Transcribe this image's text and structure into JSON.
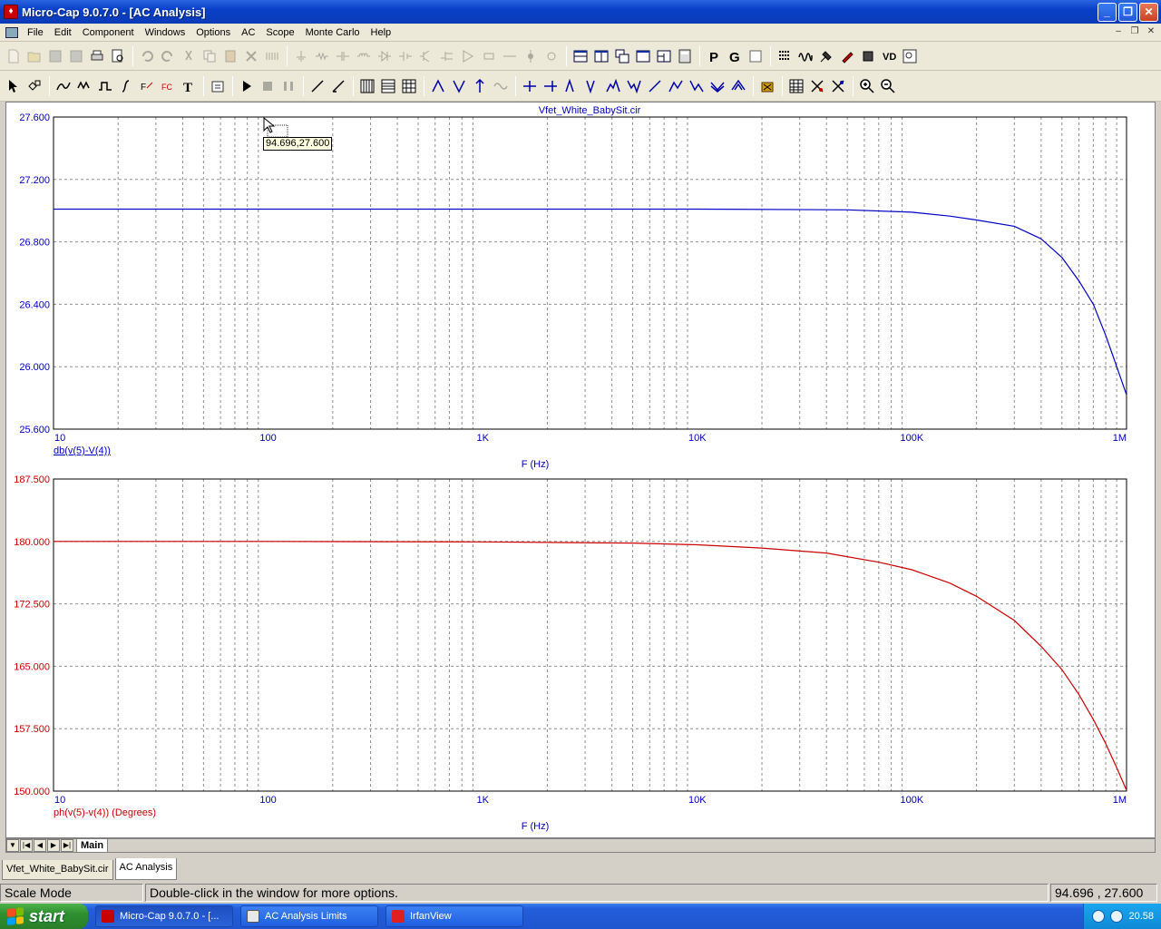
{
  "window": {
    "title": "Micro-Cap 9.0.7.0 - [AC Analysis]",
    "app_icon": "microcap-icon",
    "controls": [
      "minimize-icon",
      "restore-icon",
      "close-icon"
    ]
  },
  "menu": {
    "items": [
      "File",
      "Edit",
      "Component",
      "Windows",
      "Options",
      "AC",
      "Scope",
      "Monte Carlo",
      "Help"
    ]
  },
  "plot": {
    "circuit_title": "Vfet_White_BabySit.cir",
    "cursor_readout": "94.696,27.600",
    "colors": {
      "top_trace": "#0000c8",
      "bottom_trace": "#cc0000",
      "axis_text": "#0000c0",
      "grid": "#808080"
    }
  },
  "chart_data": [
    {
      "type": "line",
      "title": "Vfet_White_BabySit.cir",
      "xlabel": "F (Hz)",
      "ylabel": "db(v(5)-V(4))",
      "xscale": "log",
      "xlim": [
        10,
        1000000
      ],
      "ylim": [
        25.6,
        27.6
      ],
      "x_tick_labels": [
        "10",
        "100",
        "1K",
        "10K",
        "100K",
        "1M"
      ],
      "y_tick_labels": [
        "27.600",
        "27.200",
        "26.800",
        "26.400",
        "26.000",
        "25.600"
      ],
      "grid": true,
      "series": [
        {
          "name": "db(v(5)-V(4))",
          "color": "#0000c8",
          "x": [
            10,
            100,
            1000,
            10000,
            50000,
            100000,
            150000,
            200000,
            300000,
            400000,
            500000,
            600000,
            700000,
            800000,
            900000,
            1000000
          ],
          "y": [
            27.01,
            27.01,
            27.01,
            27.01,
            27.005,
            26.99,
            26.965,
            26.94,
            26.9,
            26.82,
            26.7,
            26.55,
            26.4,
            26.2,
            26.0,
            25.82
          ]
        }
      ]
    },
    {
      "type": "line",
      "xlabel": "F (Hz)",
      "ylabel": "ph(v(5)-v(4)) (Degrees)",
      "xscale": "log",
      "xlim": [
        10,
        1000000
      ],
      "ylim": [
        150,
        187.5
      ],
      "x_tick_labels": [
        "10",
        "100",
        "1K",
        "10K",
        "100K",
        "1M"
      ],
      "y_tick_labels": [
        "187.500",
        "180.000",
        "172.500",
        "165.000",
        "157.500",
        "150.000"
      ],
      "grid": true,
      "series": [
        {
          "name": "ph(v(5)-v(4)) (Degrees)",
          "color": "#cc0000",
          "x": [
            10,
            100,
            1000,
            5000,
            10000,
            20000,
            40000,
            70000,
            100000,
            150000,
            200000,
            300000,
            400000,
            500000,
            600000,
            700000,
            800000,
            900000,
            1000000
          ],
          "y": [
            180.0,
            180.0,
            179.95,
            179.8,
            179.6,
            179.2,
            178.6,
            177.5,
            176.6,
            175.0,
            173.4,
            170.5,
            167.4,
            164.6,
            161.6,
            158.6,
            155.7,
            152.8,
            150.1
          ]
        }
      ]
    }
  ],
  "sheets": {
    "main_tab": "Main"
  },
  "doc_tabs": [
    "Vfet_White_BabySit.cir",
    "AC Analysis"
  ],
  "status": {
    "mode": "Scale Mode",
    "message": "Double-click in the window for more options.",
    "coords": "94.696 , 27.600"
  },
  "taskbar": {
    "start_label": "start",
    "tasks": [
      "Micro-Cap 9.0.7.0 - [...",
      "AC Analysis Limits",
      "IrfanView"
    ],
    "clock": "20.58"
  }
}
